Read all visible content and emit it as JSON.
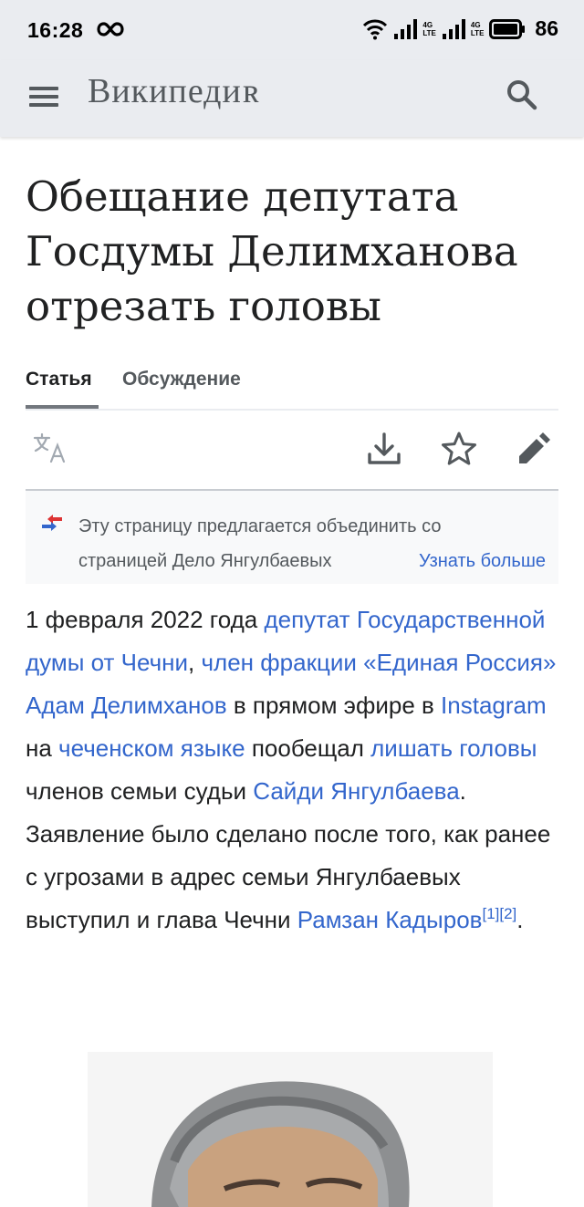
{
  "status_bar": {
    "time": "16:28",
    "network_label": "4G",
    "network_sub": "LTE",
    "battery": "86"
  },
  "header": {
    "logo_main": "Википеди",
    "logo_end": "я",
    "menu_icon": "hamburger-menu-icon",
    "search_icon": "search-icon"
  },
  "article": {
    "title": "Обещание депутата Госдумы Делимханова отрезать головы",
    "tabs": [
      {
        "label": "Статья",
        "active": true
      },
      {
        "label": "Обсуждение",
        "active": false
      }
    ],
    "toolbar": {
      "icons": [
        "translate-icon",
        "download-icon",
        "star-icon",
        "edit-pencil-icon"
      ]
    },
    "notice": {
      "line1": "Эту страницу предлагается объединить со",
      "line2": "страницей Дело Янгулбаевых",
      "link": "Узнать больше"
    },
    "paragraph": {
      "t1": "1 февраля 2022 года ",
      "l1": "депутат Государственной думы от Чечни",
      "t2": ", ",
      "l2": "член фракции «Единая Россия» Адам Делимханов",
      "t3": " в прямом эфире в ",
      "l3": "Instagram",
      "t4": " на ",
      "l4": "чеченском языке",
      "t5": " пообещал ",
      "l5": "лишать головы",
      "t6": " членов семьи судьи ",
      "l6": "Сайди Янгулбаева",
      "t7": ". Заявление было сделано после того, как ранее с угрозами в адрес семьи Янгулбаевых выступил и глава Чечни ",
      "l7": "Рамзан Кадыров",
      "ref1": "[1]",
      "ref2": "[2]",
      "t8": "."
    }
  },
  "colors": {
    "link": "#3366cc",
    "header_bg": "#eaecf0",
    "text": "#202122",
    "muted": "#54595d"
  }
}
